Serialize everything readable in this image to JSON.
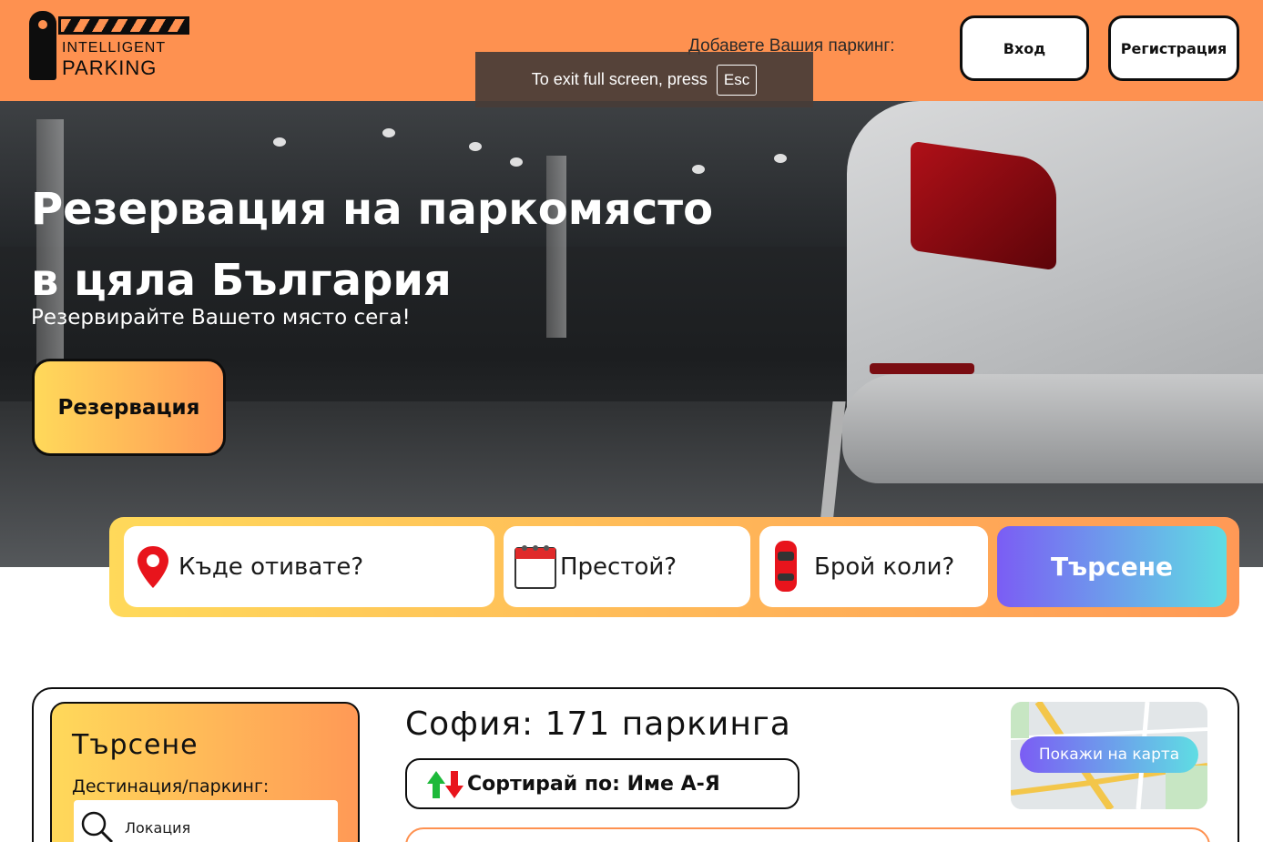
{
  "header": {
    "logo": {
      "line1": "INTELLIGENT",
      "line2": "PARKING"
    },
    "add_parking_label": "Добавете Вашия паркинг:",
    "login_label": "Вход",
    "register_label": "Регистрация",
    "bg_color": "#fe9150"
  },
  "fullscreen_toast": {
    "text": "To exit full screen, press",
    "key": "Esc"
  },
  "hero": {
    "title_line1": "Резервация на паркомясто",
    "title_line2": "в цяла България",
    "subtitle": "Резервирайте Вашето място сега!",
    "cta_label": "Резервация"
  },
  "search": {
    "where_label": "Къде отивате?",
    "where_icon": "map-pin-icon",
    "stay_label": "Престой?",
    "stay_icon": "calendar-icon",
    "cars_label": "Брой коли?",
    "cars_icon": "car-icon",
    "submit_label": "Търсене"
  },
  "results": {
    "filters": {
      "title": "Търсене",
      "destination_label": "Дестинация/паркинг:",
      "location_placeholder": "Локация",
      "location_icon": "magnifier-icon"
    },
    "city_title": "София: 171 паркинга",
    "sort_label": "Сортирай по: Име А-Я",
    "sort_icon": "sort-arrows-icon",
    "map_button_label": "Покажи на карта"
  },
  "colors": {
    "accent_orange": "#fe9150",
    "gradient_yellow": "#ffd95a",
    "gradient_purple": "#7b5df4",
    "gradient_cyan": "#5fdde3"
  }
}
